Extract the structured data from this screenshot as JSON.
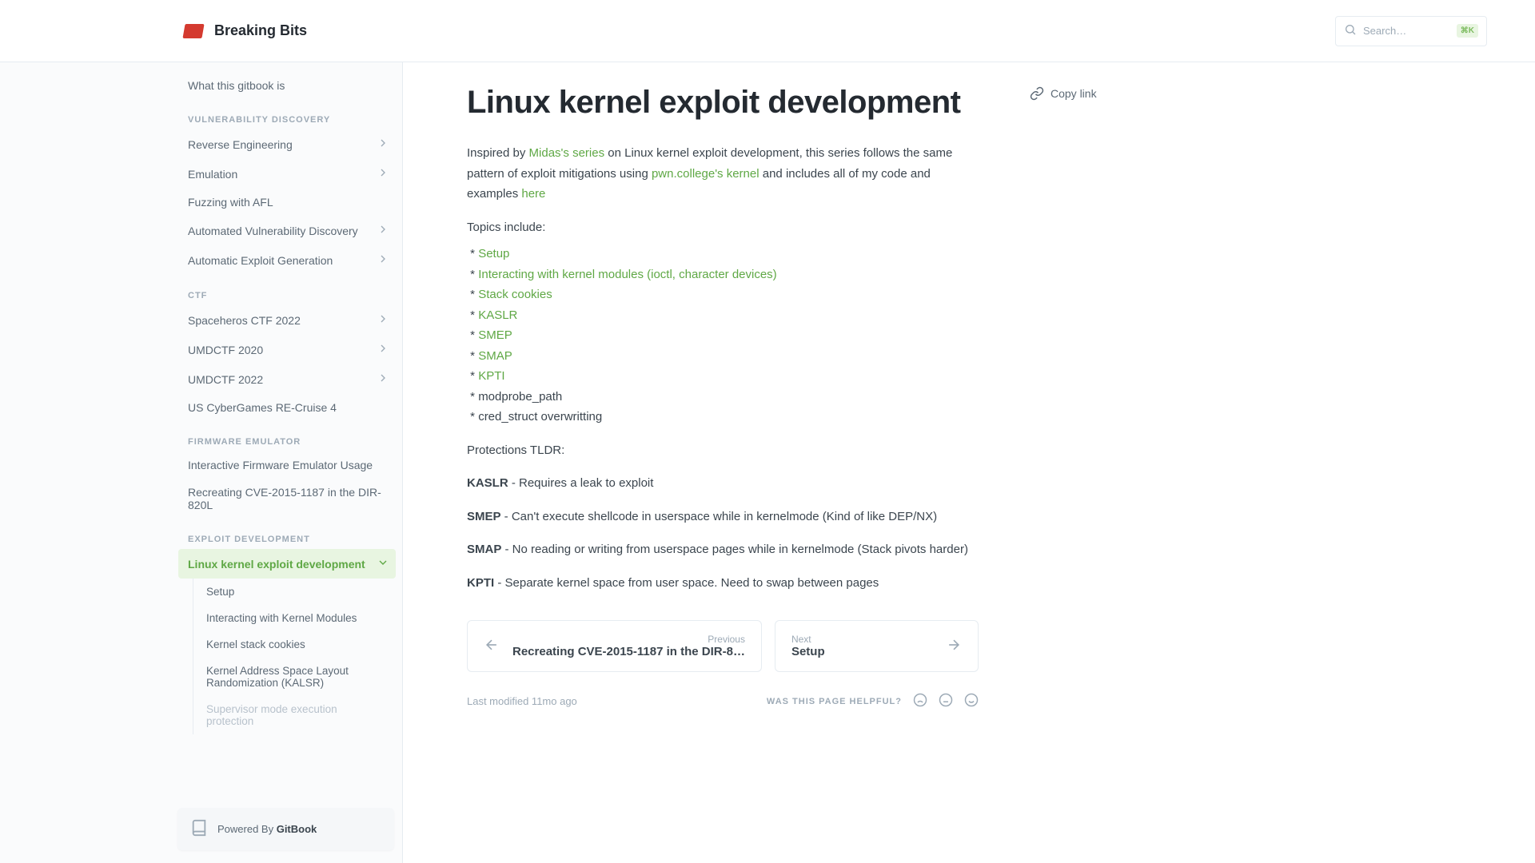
{
  "header": {
    "title": "Breaking Bits",
    "search_placeholder": "Search…",
    "search_kbd": "⌘K"
  },
  "sidebar": {
    "first_link": "What this gitbook is",
    "sections": [
      {
        "label": "VULNERABILITY DISCOVERY",
        "items": [
          {
            "label": "Reverse Engineering",
            "expandable": true
          },
          {
            "label": "Emulation",
            "expandable": true
          },
          {
            "label": "Fuzzing with AFL",
            "expandable": false
          },
          {
            "label": "Automated Vulnerability Discovery",
            "expandable": true
          },
          {
            "label": "Automatic Exploit Generation",
            "expandable": true
          }
        ]
      },
      {
        "label": "CTF",
        "items": [
          {
            "label": "Spaceheros CTF 2022",
            "expandable": true
          },
          {
            "label": "UMDCTF 2020",
            "expandable": true
          },
          {
            "label": "UMDCTF 2022",
            "expandable": true
          },
          {
            "label": "US CyberGames RE-Cruise 4",
            "expandable": false
          }
        ]
      },
      {
        "label": "FIRMWARE EMULATOR",
        "items": [
          {
            "label": "Interactive Firmware Emulator Usage",
            "expandable": false
          },
          {
            "label": "Recreating CVE-2015-1187 in the DIR-820L",
            "expandable": false
          }
        ]
      },
      {
        "label": "EXPLOIT DEVELOPMENT",
        "items": [
          {
            "label": "Linux kernel exploit development",
            "expandable": true,
            "active": true,
            "children": [
              "Setup",
              "Interacting with Kernel Modules",
              "Kernel stack cookies",
              "Kernel Address Space Layout Randomization (KALSR)",
              "Supervisor mode execution protection"
            ]
          }
        ]
      }
    ],
    "footer": {
      "powered_by": "Powered By ",
      "brand": "GitBook"
    }
  },
  "page": {
    "title": "Linux kernel exploit development",
    "intro": {
      "p1a": "Inspired by ",
      "link1": "Midas's series",
      "p1b": " on Linux kernel exploit development, this series follows the same pattern of exploit mitigations using ",
      "link2": "pwn.college's kernel",
      "p1c": " and includes all of my code and examples ",
      "link3": "here"
    },
    "topics_label": "Topics include:",
    "topics": [
      {
        "text": "Setup",
        "link": true
      },
      {
        "text": "Interacting with kernel modules (ioctl,  character devices)",
        "link": true
      },
      {
        "text": "Stack cookies",
        "link": true
      },
      {
        "text": "KASLR",
        "link": true
      },
      {
        "text": "SMEP",
        "link": true
      },
      {
        "text": "SMAP",
        "link": true
      },
      {
        "text": "KPTI",
        "link": true
      },
      {
        "text": "modprobe_path",
        "link": false
      },
      {
        "text": "cred_struct overwritting",
        "link": false
      }
    ],
    "tldr_label": "Protections TLDR:",
    "protections": [
      {
        "name": "KASLR",
        "desc": " - Requires a leak to exploit"
      },
      {
        "name": "SMEP",
        "desc": " - Can't execute shellcode in userspace while in kernelmode (Kind of like DEP/NX)"
      },
      {
        "name": "SMAP",
        "desc": " - No reading or writing from userspace pages while in kernelmode (Stack pivots harder)"
      },
      {
        "name": "KPTI",
        "desc": " - Separate kernel space from user space. Need to swap between pages"
      }
    ],
    "nav": {
      "prev": {
        "label": "Previous",
        "title": "Recreating CVE-2015-1187 in the DIR-8…"
      },
      "next": {
        "label": "Next",
        "title": "Setup"
      }
    },
    "last_modified": "Last modified 11mo ago",
    "helpful_label": "WAS THIS PAGE HELPFUL?"
  },
  "right_rail": {
    "copy_link": "Copy link"
  }
}
